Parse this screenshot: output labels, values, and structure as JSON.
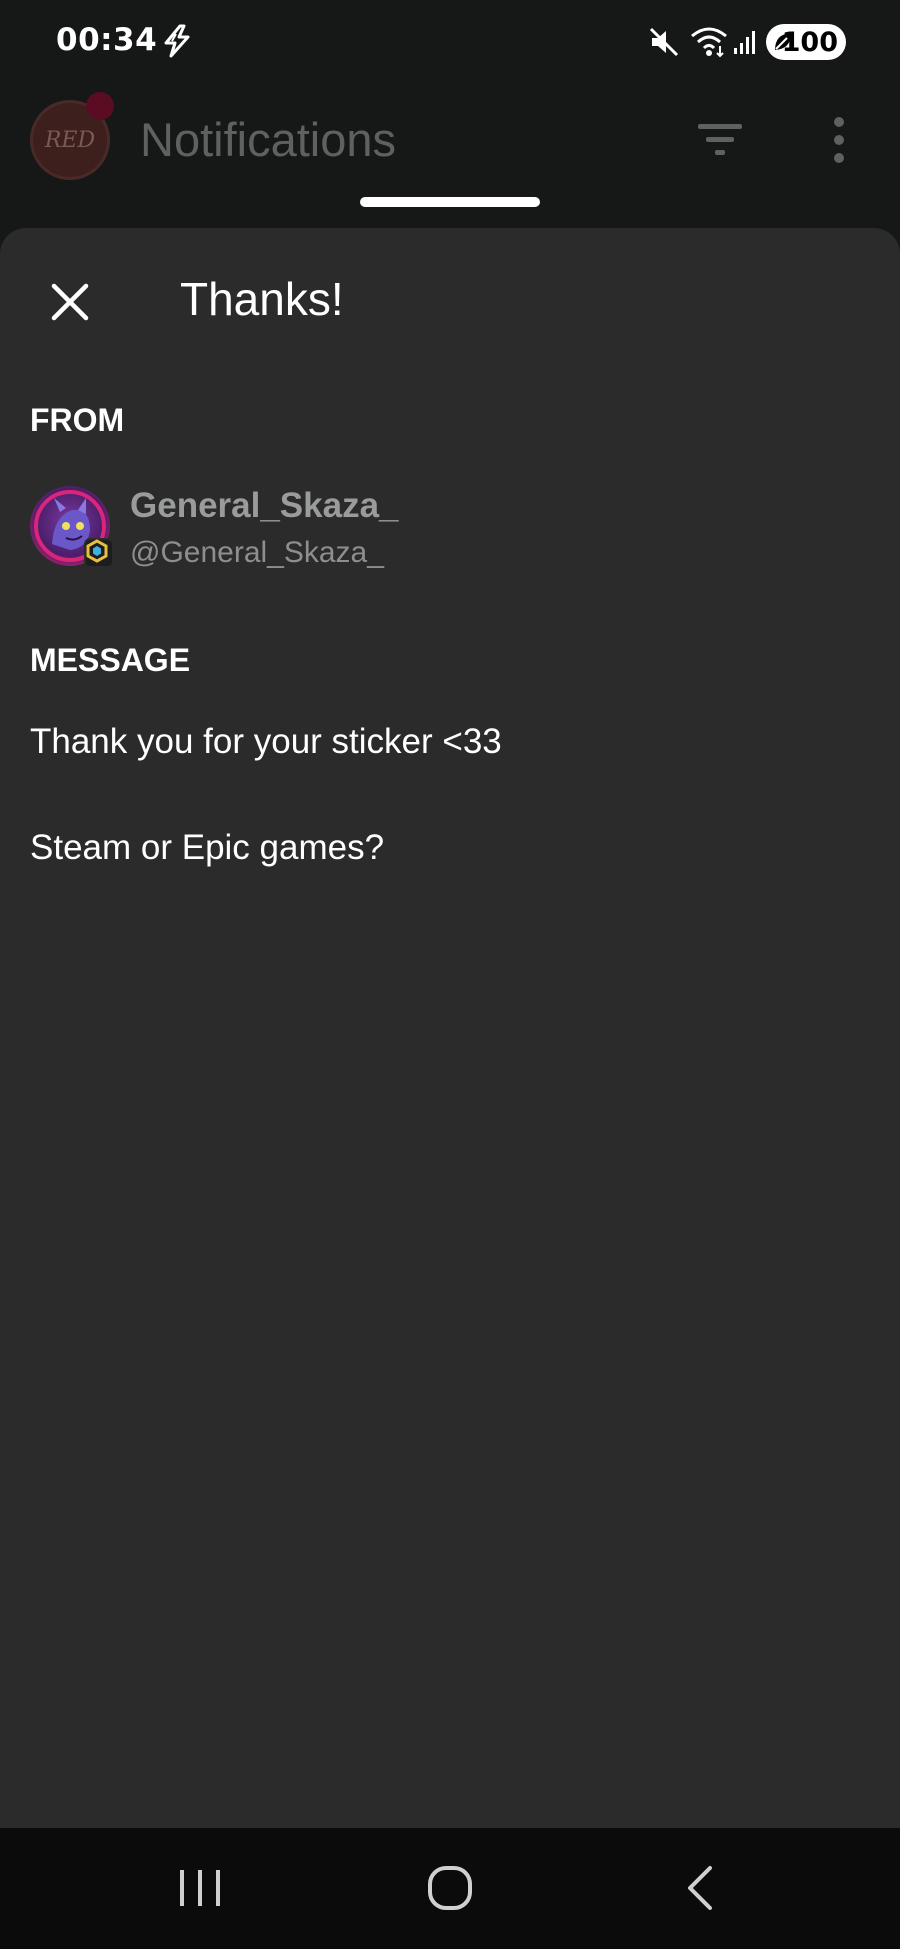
{
  "status_bar": {
    "time": "00:34",
    "battery": "100",
    "icons": [
      "flash-icon",
      "mute-icon",
      "wifi-icon",
      "signal-icon",
      "battery-saver-icon"
    ]
  },
  "header": {
    "logo_text": "RED",
    "title": "Notifications",
    "icons": [
      "filter-icon",
      "more-vertical-icon"
    ]
  },
  "sheet": {
    "title": "Thanks!",
    "from_label": "FROM",
    "sender": {
      "name": "General_Skaza_",
      "handle": "@General_Skaza_"
    },
    "message_label": "MESSAGE",
    "message_lines": [
      "Thank you for your sticker <33",
      "Steam or Epic games?"
    ]
  },
  "nav_bar": {
    "icons": [
      "recents-icon",
      "home-icon",
      "back-icon"
    ]
  },
  "colors": {
    "sheet_background": "#2a2b2a",
    "app_background": "#161817",
    "nav_background": "#0b0b0b",
    "text_primary": "#ffffff",
    "text_secondary": "#9a9c9b"
  }
}
